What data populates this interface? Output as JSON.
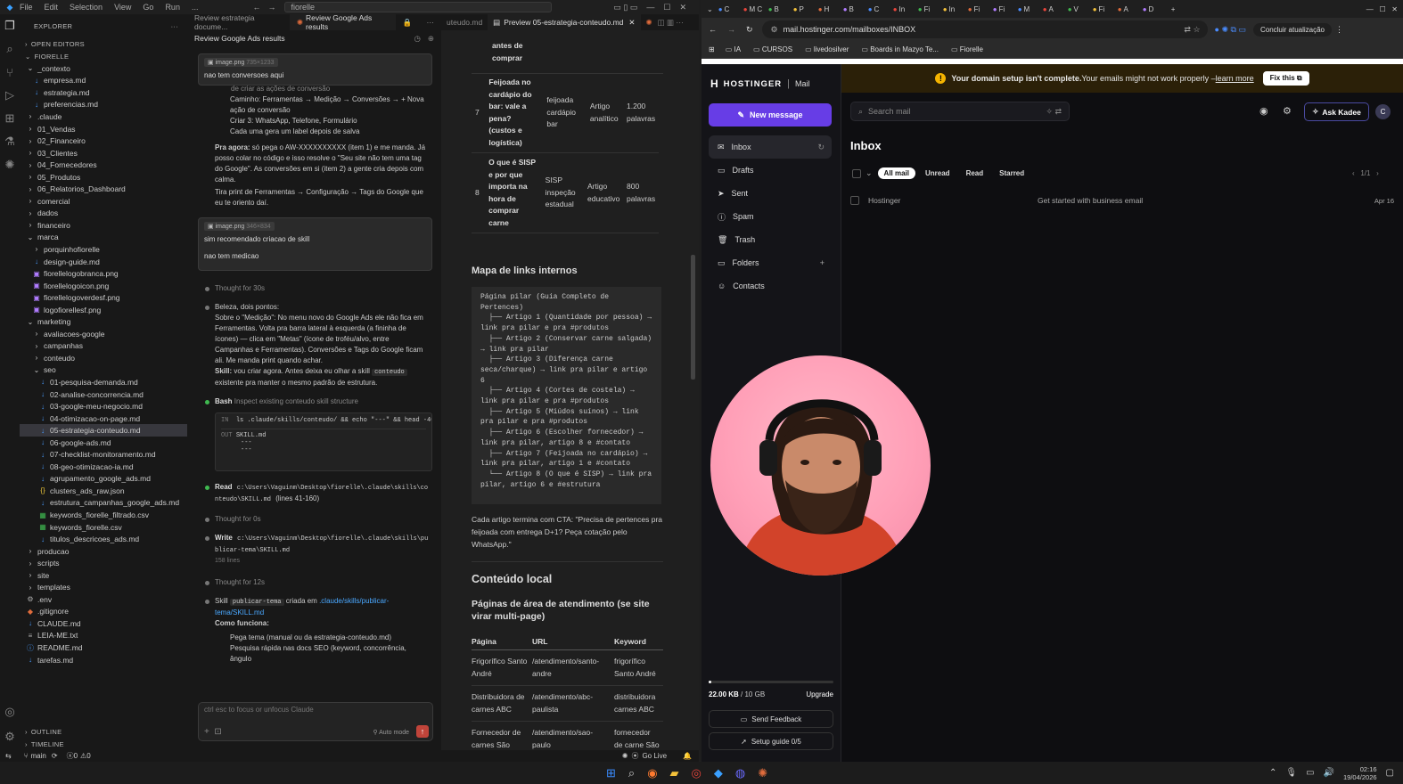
{
  "vscode": {
    "menu": [
      "File",
      "Edit",
      "Selection",
      "View",
      "Go",
      "Run",
      "..."
    ],
    "search_text": "fiorelle",
    "explorer_title": "EXPLORER",
    "open_editors": "OPEN EDITORS",
    "project": "FIORELLE",
    "tree": [
      {
        "l": "_contexto",
        "d": 1,
        "t": "folder-open"
      },
      {
        "l": "empresa.md",
        "d": 2,
        "t": "md"
      },
      {
        "l": "estrategia.md",
        "d": 2,
        "t": "md"
      },
      {
        "l": "preferencias.md",
        "d": 2,
        "t": "md"
      },
      {
        "l": ".claude",
        "d": 1,
        "t": "folder"
      },
      {
        "l": "01_Vendas",
        "d": 1,
        "t": "folder"
      },
      {
        "l": "02_Financeiro",
        "d": 1,
        "t": "folder"
      },
      {
        "l": "03_Clientes",
        "d": 1,
        "t": "folder"
      },
      {
        "l": "04_Fornecedores",
        "d": 1,
        "t": "folder"
      },
      {
        "l": "05_Produtos",
        "d": 1,
        "t": "folder"
      },
      {
        "l": "06_Relatorios_Dashboard",
        "d": 1,
        "t": "folder"
      },
      {
        "l": "comercial",
        "d": 1,
        "t": "folder"
      },
      {
        "l": "dados",
        "d": 1,
        "t": "folder"
      },
      {
        "l": "financeiro",
        "d": 1,
        "t": "folder"
      },
      {
        "l": "marca",
        "d": 1,
        "t": "folder-open"
      },
      {
        "l": "porquinhofiorelle",
        "d": 2,
        "t": "folder"
      },
      {
        "l": "design-guide.md",
        "d": 2,
        "t": "md"
      },
      {
        "l": "fiorellelogobranca.png",
        "d": 2,
        "t": "png"
      },
      {
        "l": "fiorellelogoicon.png",
        "d": 2,
        "t": "png"
      },
      {
        "l": "fiorellelogoverdesf.png",
        "d": 2,
        "t": "png"
      },
      {
        "l": "logofiorellesf.png",
        "d": 2,
        "t": "png"
      },
      {
        "l": "marketing",
        "d": 1,
        "t": "folder-open"
      },
      {
        "l": "avaliacoes-google",
        "d": 2,
        "t": "folder"
      },
      {
        "l": "campanhas",
        "d": 2,
        "t": "folder"
      },
      {
        "l": "conteudo",
        "d": 2,
        "t": "folder"
      },
      {
        "l": "seo",
        "d": 2,
        "t": "folder-open"
      },
      {
        "l": "01-pesquisa-demanda.md",
        "d": 3,
        "t": "md"
      },
      {
        "l": "02-analise-concorrencia.md",
        "d": 3,
        "t": "md"
      },
      {
        "l": "03-google-meu-negocio.md",
        "d": 3,
        "t": "md"
      },
      {
        "l": "04-otimizacao-on-page.md",
        "d": 3,
        "t": "md"
      },
      {
        "l": "05-estrategia-conteudo.md",
        "d": 3,
        "t": "md",
        "sel": true
      },
      {
        "l": "06-google-ads.md",
        "d": 3,
        "t": "md"
      },
      {
        "l": "07-checklist-monitoramento.md",
        "d": 3,
        "t": "md"
      },
      {
        "l": "08-geo-otimizacao-ia.md",
        "d": 3,
        "t": "md"
      },
      {
        "l": "agrupamento_google_ads.md",
        "d": 3,
        "t": "md"
      },
      {
        "l": "clusters_ads_raw.json",
        "d": 3,
        "t": "json"
      },
      {
        "l": "estrutura_campanhas_google_ads.md",
        "d": 3,
        "t": "md"
      },
      {
        "l": "keywords_fiorelle_filtrado.csv",
        "d": 3,
        "t": "csv"
      },
      {
        "l": "keywords_fiorelle.csv",
        "d": 3,
        "t": "csv"
      },
      {
        "l": "titulos_descricoes_ads.md",
        "d": 3,
        "t": "md"
      },
      {
        "l": "producao",
        "d": 1,
        "t": "folder"
      },
      {
        "l": "scripts",
        "d": 1,
        "t": "folder"
      },
      {
        "l": "site",
        "d": 1,
        "t": "folder"
      },
      {
        "l": "templates",
        "d": 1,
        "t": "folder"
      },
      {
        "l": ".env",
        "d": 1,
        "t": "env"
      },
      {
        "l": ".gitignore",
        "d": 1,
        "t": "git"
      },
      {
        "l": "CLAUDE.md",
        "d": 1,
        "t": "md"
      },
      {
        "l": "LEIA-ME.txt",
        "d": 1,
        "t": "txt"
      },
      {
        "l": "README.md",
        "d": 1,
        "t": "info"
      },
      {
        "l": "tarefas.md",
        "d": 1,
        "t": "md"
      }
    ],
    "outline": "OUTLINE",
    "timeline": "TIMELINE",
    "status": {
      "branch": "main",
      "errors": "0",
      "warnings": "0",
      "golive": "Go Live"
    }
  },
  "chat": {
    "tabs": [
      "Review estrategia docume...",
      "Review Google Ads results"
    ],
    "title": "Review Google Ads results",
    "msg1": {
      "chip": "image.png",
      "dims": "735×1233",
      "text": "nao tem conversoes aqui"
    },
    "step_intro": "de criar as ações de conversão",
    "steps": [
      "Caminho: Ferramentas → Medição → Conversões → + Nova ação de conversão",
      "Criar 3: WhatsApp, Telefone, Formulário",
      "Cada uma gera um label depois de salva"
    ],
    "p1_bold": "Pra agora:",
    "p1": " só pega o AW-XXXXXXXXXX (item 1) e me manda. Já posso colar no código e isso resolve o \"Seu site não tem uma tag do Google\". As conversões em si (item 2) a gente cria depois com calma.",
    "p2": "Tira print de Ferramentas → Configuração → Tags do Google que eu te oriento daí.",
    "msg2": {
      "chip": "image.png",
      "dims": "346×834",
      "text1": "sim recomendado criacao de skill",
      "text2": "nao tem medicao"
    },
    "thought1": "Thought for 30s",
    "p3": "Beleza, dois pontos:",
    "p4": "Sobre o \"Medição\": No menu novo do Google Ads ele não fica em Ferramentas. Volta pra barra lateral à esquerda (a fininha de ícones) — clica em \"Metas\" (ícone de troféu/alvo, entre Campanhas e Ferramentas). Conversões e Tags do Google ficam ali. Me manda print quando achar.",
    "p5a": "Skill:",
    "p5": " vou criar agora. Antes deixa eu olhar a skill ",
    "p5code": "conteudo",
    "p5b": " existente pra manter o mesmo padrão de estrutura.",
    "bash_label": "Bash",
    "bash_desc": "Inspect existing conteudo skill structure",
    "bash_in": "ls .claude/skills/conteudo/ && echo \"---\" && head -40 .",
    "bash_out": [
      "SKILL.md",
      "---",
      "---"
    ],
    "read_label": "Read",
    "read_path": "c:\\Users\\Vaguinm\\Desktop\\fiorelle\\.claude\\skills\\conteudo\\SKILL.md",
    "read_lines": "(lines 41-160)",
    "thought2": "Thought for 0s",
    "write_label": "Write",
    "write_path": "c:\\Users\\Vaguinm\\Desktop\\fiorelle\\.claude\\skills\\publicar-tema\\SKILL.md",
    "write_lines": "158 lines",
    "thought3": "Thought for 12s",
    "skill_a": "Skill ",
    "skill_code": "publicar-tema",
    "skill_b": " criada em ",
    "skill_link": ".claude/skills/publicar-tema/SKILL.md",
    "como": "Como funciona:",
    "como_items": [
      "Pega tema (manual ou da estrategia-conteudo.md)",
      "Pesquisa rápida nas docs SEO (keyword, concorrência, ângulo"
    ],
    "input_placeholder": "ctrl esc to focus or unfocus Claude",
    "auto_mode": "Auto mode"
  },
  "preview": {
    "tab": "Preview 05-estrategia-conteudo.md",
    "top_fragment": [
      "antes de",
      "comprar"
    ],
    "rows": [
      {
        "n": "7",
        "title": "Feijoada no cardápio do bar: vale a pena? (custos e logística)",
        "kw": "feijoada cardápio bar",
        "type": "Artigo analítico",
        "words": "1.200 palavras"
      },
      {
        "n": "8",
        "title": "O que é SISP e por que importa na hora de comprar carne",
        "kw": "SISP inspeção estadual",
        "type": "Artigo educativo",
        "words": "800 palavras"
      }
    ],
    "h_map": "Mapa de links internos",
    "code": "Página pilar (Guia Completo de\nPertences)\n  ├── Artigo 1 (Quantidade por pessoa) →\nlink pra pilar e pra #produtos\n  ├── Artigo 2 (Conservar carne salgada)\n→ link pra pilar\n  ├── Artigo 3 (Diferença carne\nseca/charque) → link pra pilar e artigo\n6\n  ├── Artigo 4 (Cortes de costela) →\nlink pra pilar e pra #produtos\n  ├── Artigo 5 (Miúdos suínos) → link\npra pilar e pra #produtos\n  ├── Artigo 6 (Escolher fornecedor) →\nlink pra pilar, artigo 8 e #contato\n  ├── Artigo 7 (Feijoada no cardápio) →\nlink pra pilar, artigo 1 e #contato\n  └── Artigo 8 (O que é SISP) → link pra\npilar, artigo 6 e #estrutura",
    "cta": "Cada artigo termina com CTA: \"Precisa de pertences pra feijoada com entrega D+1? Peça cotação pelo WhatsApp.\"",
    "h_local": "Conteúdo local",
    "h_pages": "Páginas de área de atendimento (se site virar multi-page)",
    "cols": [
      "Página",
      "URL",
      "Keyword"
    ],
    "table": [
      [
        "Frigorífico Santo André",
        "/atendimento/santo-andre",
        "frigorífico Santo André"
      ],
      [
        "Distribuidora de carnes ABC",
        "/atendimento/abc-paulista",
        "distribuidora carnes ABC"
      ],
      [
        "Fornecedor de carnes São Paulo",
        "/atendimento/sao-paulo",
        "fornecedor de carne São Paulo"
      ]
    ]
  },
  "browser": {
    "url": "mail.hostinger.com/mailboxes/INBOX",
    "update_btn": "Concluir atualização",
    "bookmarks": [
      "IA",
      "CURSOS",
      "livedosilver",
      "Boards in Mazyo Te...",
      "Fiorelle"
    ],
    "tabs": [
      "C",
      "M C",
      "B",
      "P",
      "H",
      "B",
      "C",
      "In",
      "Fi",
      "In",
      "Fi",
      "Fi",
      "M",
      "A",
      "V",
      "Fi",
      "A",
      "D"
    ]
  },
  "hostinger": {
    "brand": "HOSTINGER",
    "product": "Mail",
    "new_message": "New message",
    "nav": [
      "Inbox",
      "Drafts",
      "Sent",
      "Spam",
      "Trash",
      "Folders",
      "Contacts"
    ],
    "banner_bold": "Your domain setup isn't complete.",
    "banner": " Your emails might not work properly – ",
    "banner_link": "learn more",
    "fix": "Fix this",
    "search_placeholder": "Search mail",
    "ask": "Ask Kadee",
    "avatar": "C",
    "inbox_title": "Inbox",
    "filters": [
      "All mail",
      "Unread",
      "Read",
      "Starred"
    ],
    "pager": "1/1",
    "emails": [
      {
        "from": "Hostinger",
        "subject": "Get started with business email",
        "date": "Apr 16"
      }
    ],
    "storage": "22.00 KB",
    "storage_total": "/ 10 GB",
    "storage_fraction": 0.002,
    "upgrade": "Upgrade",
    "feedback": "Send Feedback",
    "setup": "Setup guide 0/5"
  },
  "taskbar": {
    "time": "02:16",
    "date": "19/04/2026"
  }
}
